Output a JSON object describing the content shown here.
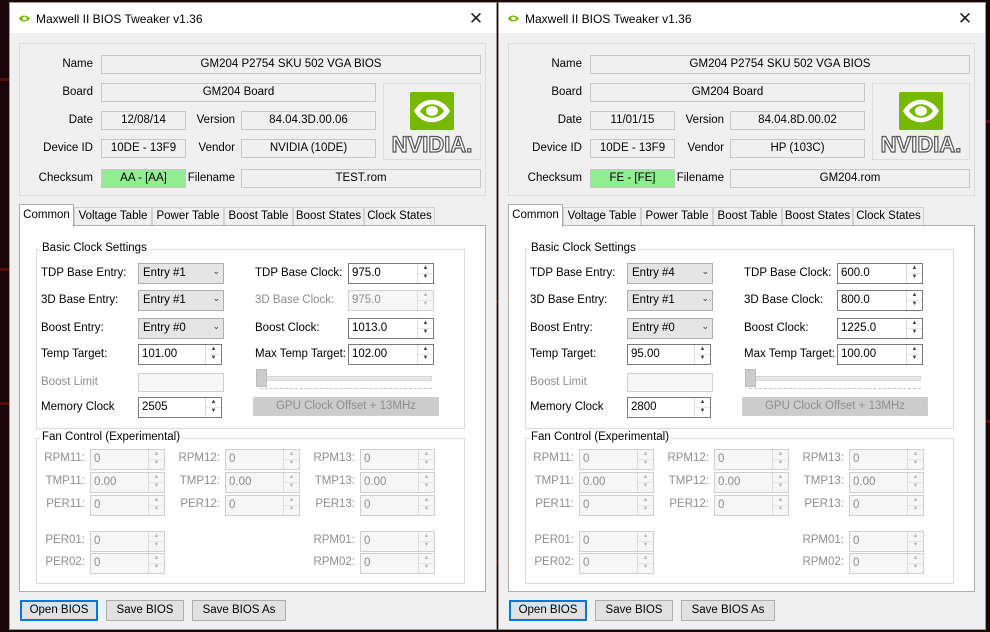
{
  "windows": [
    {
      "title": "Maxwell II BIOS Tweaker v1.36",
      "info": {
        "name_label": "Name",
        "name": "GM204 P2754 SKU 502 VGA BIOS",
        "board_label": "Board",
        "board": "GM204 Board",
        "date_label": "Date",
        "date": "12/08/14",
        "version_label": "Version",
        "version": "84.04.3D.00.06",
        "device_label": "Device ID",
        "device_id": "10DE - 13F9",
        "vendor_label": "Vendor",
        "vendor": "NVIDIA (10DE)",
        "checksum_label": "Checksum",
        "checksum": "AA - [AA]",
        "filename_label": "Filename",
        "filename": "TEST.rom"
      },
      "logo_text": "NVIDIA.",
      "tabs": [
        "Common",
        "Voltage Table",
        "Power Table",
        "Boost Table",
        "Boost States",
        "Clock States"
      ],
      "clock": {
        "group_title": "Basic Clock Settings",
        "tdp_entry_label": "TDP Base Entry:",
        "tdp_entry": "Entry #1",
        "d3_entry_label": "3D Base Entry:",
        "d3_entry": "Entry #1",
        "boost_entry_label": "Boost Entry:",
        "boost_entry": "Entry #0",
        "temp_target_label": "Temp Target:",
        "temp_target": "101.00",
        "boost_limit_label": "Boost Limit",
        "memory_clock_label": "Memory Clock",
        "memory_clock": "2505",
        "tdp_clock_label": "TDP Base Clock:",
        "tdp_clock": "975.0",
        "d3_clock_label": "3D Base Clock:",
        "d3_clock": "975.0",
        "boost_clock_label": "Boost Clock:",
        "boost_clock": "1013.0",
        "max_temp_label": "Max Temp Target:",
        "max_temp": "102.00",
        "offset_button": "GPU Clock Offset + 13MHz"
      },
      "fan": {
        "group_title": "Fan Control (Experimental)",
        "rows": [
          [
            {
              "label": "RPM11:",
              "value": "0"
            },
            {
              "label": "RPM12:",
              "value": "0"
            },
            {
              "label": "RPM13:",
              "value": "0"
            }
          ],
          [
            {
              "label": "TMP11:",
              "value": "0.00"
            },
            {
              "label": "TMP12:",
              "value": "0.00"
            },
            {
              "label": "TMP13:",
              "value": "0.00"
            }
          ],
          [
            {
              "label": "PER11:",
              "value": "0"
            },
            {
              "label": "PER12:",
              "value": "0"
            },
            {
              "label": "PER13:",
              "value": "0"
            }
          ]
        ],
        "extra": [
          [
            {
              "label": "PER01:",
              "value": "0"
            },
            {
              "label": "RPM01:",
              "value": "0"
            }
          ],
          [
            {
              "label": "PER02:",
              "value": "0"
            },
            {
              "label": "RPM02:",
              "value": "0"
            }
          ]
        ]
      },
      "buttons": {
        "open": "Open BIOS",
        "save": "Save BIOS",
        "save_as": "Save BIOS As"
      }
    },
    {
      "title": "Maxwell II BIOS Tweaker v1.36",
      "info": {
        "name_label": "Name",
        "name": "GM204 P2754 SKU 502 VGA BIOS",
        "board_label": "Board",
        "board": "GM204 Board",
        "date_label": "Date",
        "date": "11/01/15",
        "version_label": "Version",
        "version": "84.04.8D.00.02",
        "device_label": "Device ID",
        "device_id": "10DE - 13F9",
        "vendor_label": "Vendor",
        "vendor": "HP (103C)",
        "checksum_label": "Checksum",
        "checksum": "FE - [FE]",
        "filename_label": "Filename",
        "filename": "GM204.rom"
      },
      "logo_text": "NVIDIA.",
      "tabs": [
        "Common",
        "Voltage Table",
        "Power Table",
        "Boost Table",
        "Boost States",
        "Clock States"
      ],
      "clock": {
        "group_title": "Basic Clock Settings",
        "tdp_entry_label": "TDP Base Entry:",
        "tdp_entry": "Entry #4",
        "d3_entry_label": "3D Base Entry:",
        "d3_entry": "Entry #1",
        "boost_entry_label": "Boost Entry:",
        "boost_entry": "Entry #0",
        "temp_target_label": "Temp Target:",
        "temp_target": "95.00",
        "boost_limit_label": "Boost Limit",
        "memory_clock_label": "Memory Clock",
        "memory_clock": "2800",
        "tdp_clock_label": "TDP Base Clock:",
        "tdp_clock": "600.0",
        "d3_clock_label": "3D Base Clock:",
        "d3_clock": "800.0",
        "boost_clock_label": "Boost Clock:",
        "boost_clock": "1225.0",
        "max_temp_label": "Max Temp Target:",
        "max_temp": "100.00",
        "offset_button": "GPU Clock Offset + 13MHz"
      },
      "fan": {
        "group_title": "Fan Control (Experimental)",
        "rows": [
          [
            {
              "label": "RPM11:",
              "value": "0"
            },
            {
              "label": "RPM12:",
              "value": "0"
            },
            {
              "label": "RPM13:",
              "value": "0"
            }
          ],
          [
            {
              "label": "TMP11:",
              "value": "0.00"
            },
            {
              "label": "TMP12:",
              "value": "0.00"
            },
            {
              "label": "TMP13:",
              "value": "0.00"
            }
          ],
          [
            {
              "label": "PER11:",
              "value": "0"
            },
            {
              "label": "PER12:",
              "value": "0"
            },
            {
              "label": "PER13:",
              "value": "0"
            }
          ]
        ],
        "extra": [
          [
            {
              "label": "PER01:",
              "value": "0"
            },
            {
              "label": "RPM01:",
              "value": "0"
            }
          ],
          [
            {
              "label": "PER02:",
              "value": "0"
            },
            {
              "label": "RPM02:",
              "value": "0"
            }
          ]
        ]
      },
      "buttons": {
        "open": "Open BIOS",
        "save": "Save BIOS",
        "save_as": "Save BIOS As"
      }
    }
  ],
  "colors": {
    "checksum_ok": "#90ee90",
    "nvidia_green": "#76b900",
    "focus_blue": "#0078d7"
  }
}
